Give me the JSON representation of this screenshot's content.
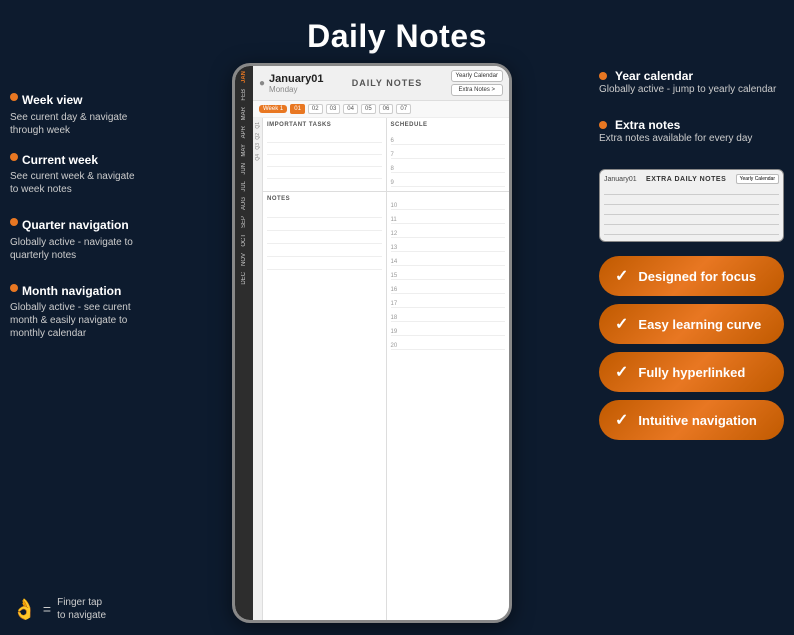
{
  "title": "Daily Notes",
  "left_annotations": [
    {
      "id": "week-view",
      "title": "Week view",
      "desc": "See curent day & navigate through week"
    },
    {
      "id": "current-week",
      "title": "Current week",
      "desc": "See curent week & navigate to week notes"
    },
    {
      "id": "quarter-nav",
      "title": "Quarter navigation",
      "desc": "Globally active - navigate to quarterly notes"
    },
    {
      "id": "month-nav",
      "title": "Month navigation",
      "desc": "Globally active - see curent month & easily navigate to monthly calendar"
    }
  ],
  "right_annotations": [
    {
      "id": "year-cal",
      "title": "Year calendar",
      "desc": "Globally active - jump to yearly calendar"
    },
    {
      "id": "extra-notes",
      "title": "Extra notes",
      "desc": "Extra notes available for every day"
    }
  ],
  "planner": {
    "date": "January01",
    "day": "Monday",
    "label": "DAILY NOTES",
    "year_btn": "Yearly Calendar",
    "extra_btn": "Extra Notes >",
    "week_label": "Week 1",
    "week_days": [
      "01",
      "02",
      "03",
      "04",
      "05",
      "06",
      "07"
    ],
    "today_day": "01",
    "tasks_header": "IMPORTANT TASKS",
    "schedule_header": "SCHEDULE",
    "notes_header": "NOTES",
    "schedule_numbers": [
      "6",
      "7",
      "8",
      "9",
      "10",
      "11",
      "12",
      "13",
      "14",
      "15",
      "16",
      "17",
      "18",
      "19",
      "20"
    ],
    "months": [
      "JAN",
      "FEB",
      "MAR",
      "APR",
      "MAY",
      "JUN",
      "JUL",
      "AUG",
      "SEP",
      "OCT",
      "NOV",
      "DEC"
    ],
    "quarters": [
      "Q1",
      "Q2",
      "Q3",
      "Q4"
    ]
  },
  "extra_notes": {
    "date": "January01",
    "label": "EXTRA DAILY NOTES",
    "btn": "Yearly Calendar"
  },
  "features": [
    {
      "id": "focus",
      "text": "Designed for focus"
    },
    {
      "id": "learning",
      "text": "Easy learning curve"
    },
    {
      "id": "hyperlinked",
      "text": "Fully hyperlinked"
    },
    {
      "id": "navigation",
      "text": "Intuitive navigation"
    }
  ],
  "footer": {
    "finger_tap_label": "Finger tap\nto navigate"
  },
  "colors": {
    "accent": "#e87722",
    "bg": "#0d1b2e",
    "text_light": "#ccc"
  }
}
